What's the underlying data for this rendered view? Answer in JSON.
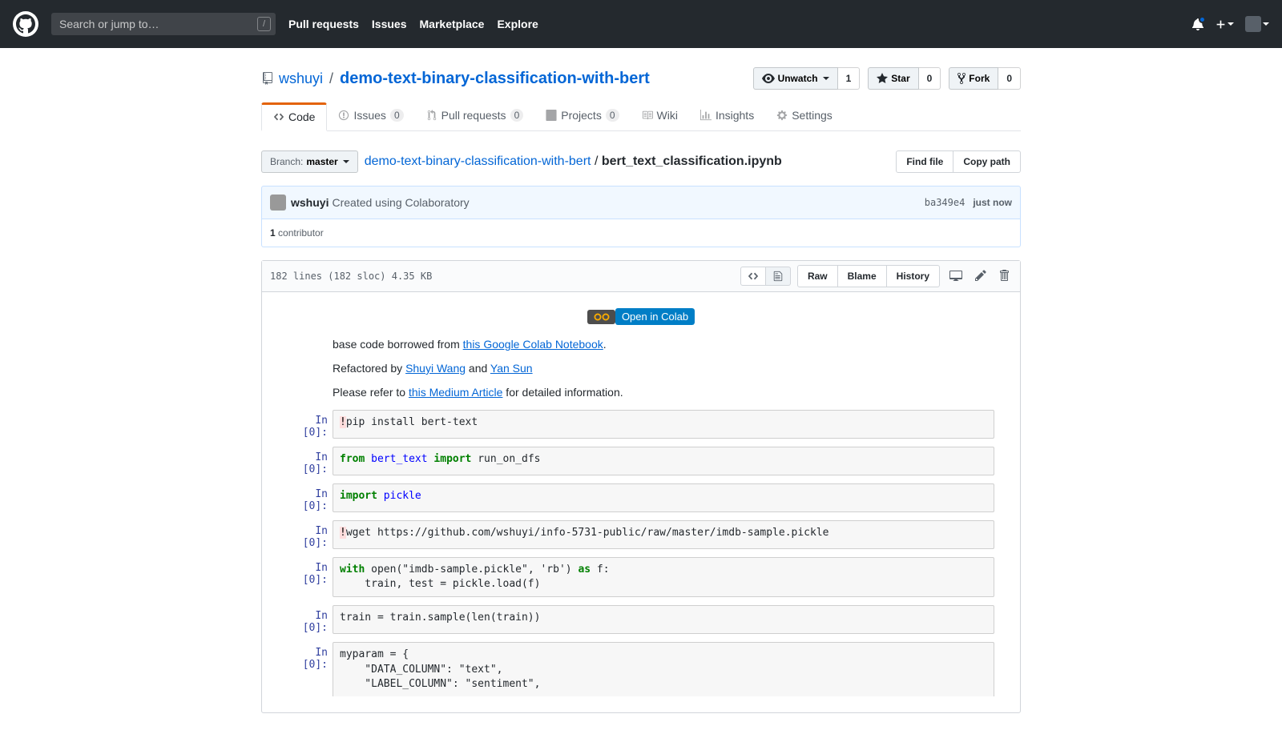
{
  "header": {
    "search_placeholder": "Search or jump to…",
    "slash": "/",
    "nav": {
      "pull_requests": "Pull requests",
      "issues": "Issues",
      "marketplace": "Marketplace",
      "explore": "Explore"
    }
  },
  "repo": {
    "owner": "wshuyi",
    "separator": "/",
    "name": "demo-text-binary-classification-with-bert",
    "actions": {
      "unwatch": "Unwatch",
      "unwatch_count": "1",
      "star": "Star",
      "star_count": "0",
      "fork": "Fork",
      "fork_count": "0"
    },
    "tabs": {
      "code": "Code",
      "issues": "Issues",
      "issues_count": "0",
      "prs": "Pull requests",
      "prs_count": "0",
      "projects": "Projects",
      "projects_count": "0",
      "wiki": "Wiki",
      "insights": "Insights",
      "settings": "Settings"
    }
  },
  "file_nav": {
    "branch_label": "Branch:",
    "branch_value": "master",
    "repo_link": "demo-text-binary-classification-with-bert",
    "sep": "/",
    "filename": "bert_text_classification.ipynb",
    "find_file": "Find file",
    "copy_path": "Copy path"
  },
  "commit": {
    "author": "wshuyi",
    "message": "Created using Colaboratory",
    "sha": "ba349e4",
    "time": "just now",
    "contributors_count": "1",
    "contributors_label": "contributor"
  },
  "file_header": {
    "info": "182 lines (182 sloc)   4.35 KB",
    "raw": "Raw",
    "blame": "Blame",
    "history": "History"
  },
  "notebook": {
    "colab_label": "Open in Colab",
    "md": {
      "p1a": "base code borrowed from ",
      "p1_link": "this Google Colab Notebook",
      "p1b": ".",
      "p2a": "Refactored by ",
      "p2_link1": "Shuyi Wang",
      "p2b": " and ",
      "p2_link2": "Yan Sun",
      "p3a": "Please refer to ",
      "p3_link": "this Medium Article",
      "p3b": " for detailed information."
    },
    "prompt": "In [0]:",
    "cells": {
      "c1": "pip install bert-text",
      "c2_from": "from",
      "c2_mod": "bert_text",
      "c2_imp": "import",
      "c2_name": "run_on_dfs",
      "c3_imp": "import",
      "c3_mod": "pickle",
      "c4": "wget https://github.com/wshuyi/info-5731-public/raw/master/imdb-sample.pickle",
      "c5_with": "with",
      "c5_open": "open",
      "c5_args": "(\"imdb-sample.pickle\", 'rb')",
      "c5_as": "as",
      "c5_f": "f:",
      "c5_body": "    train, test = pickle.load(f)",
      "c6": "train = train.sample(len(train))",
      "c7_l1": "myparam = {",
      "c7_l2": "    \"DATA_COLUMN\": \"text\",",
      "c7_l3": "    \"LABEL_COLUMN\": \"sentiment\","
    }
  }
}
